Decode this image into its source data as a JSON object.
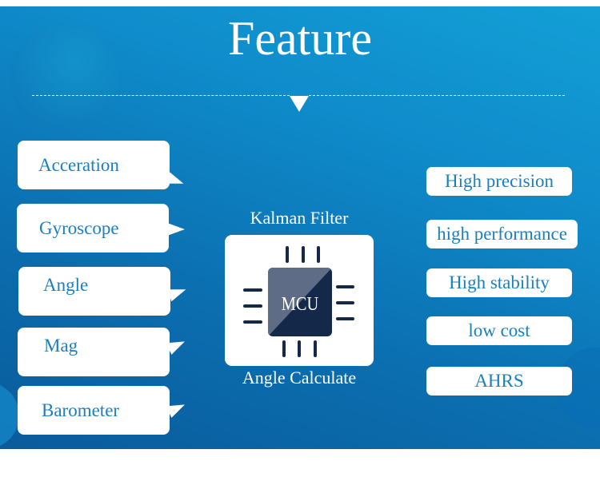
{
  "title": "Feature",
  "inputs": [
    {
      "label": "Acceration"
    },
    {
      "label": "Gyroscope"
    },
    {
      "label": "Angle"
    },
    {
      "label": "Mag"
    },
    {
      "label": "Barometer"
    }
  ],
  "center": {
    "top_label": "Kalman Filter",
    "chip_label": "MCU",
    "bottom_label": "Angle Calculate"
  },
  "features": [
    {
      "label": "High precision"
    },
    {
      "label": "high performance"
    },
    {
      "label": "High stability"
    },
    {
      "label": "low cost"
    },
    {
      "label": "AHRS"
    }
  ],
  "colors": {
    "text_blue": "#1a7fbe",
    "chip_dark": "#14284a",
    "chip_light": "#5e6c86",
    "panel_light": "#139fd6",
    "panel_dark": "#0a5b9c"
  }
}
